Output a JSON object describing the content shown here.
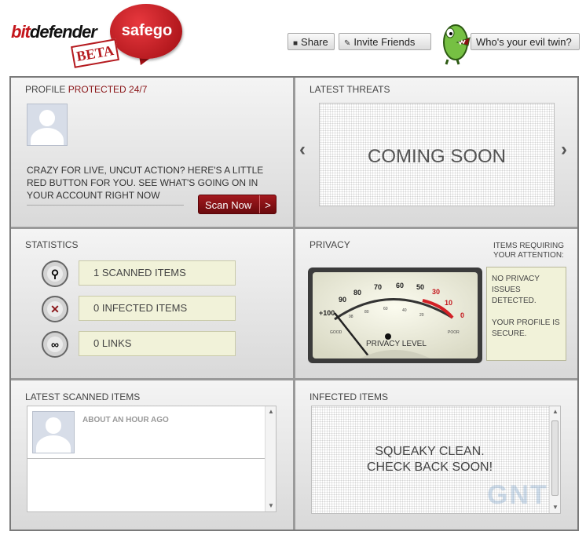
{
  "header": {
    "logo_part1": "bit",
    "logo_part2": "defender",
    "bubble_text": "safego",
    "beta_stamp": "BETA",
    "share_label": "Share",
    "invite_label": "Invite Friends",
    "evil_twin_label": "Who's your evil twin?"
  },
  "profile": {
    "title": "PROFILE",
    "title_highlight": "PROTECTED 24/7",
    "description": "CRAZY FOR LIVE, UNCUT ACTION? HERE'S A LITTLE RED BUTTON FOR YOU. SEE WHAT'S GOING ON IN YOUR ACCOUNT RIGHT NOW",
    "scan_button": "Scan Now",
    "scan_arrow": ">"
  },
  "latest_threats": {
    "title": "LATEST THREATS",
    "placeholder": "COMING SOON",
    "prev_arrow": "‹",
    "next_arrow": "›"
  },
  "statistics": {
    "title": "STATISTICS",
    "items": [
      {
        "icon": "magnifier-icon",
        "label": "1 SCANNED ITEMS"
      },
      {
        "icon": "infected-x-icon",
        "label": "0 INFECTED ITEMS"
      },
      {
        "icon": "link-icon",
        "label": "0 LINKS"
      }
    ]
  },
  "privacy": {
    "title": "PRIVACY",
    "attention_title": "ITEMS REQUIRING YOUR ATTENTION:",
    "attention_text_1": "NO PRIVACY ISSUES DETECTED.",
    "attention_text_2": "YOUR PROFILE IS SECURE.",
    "gauge_label": "PRIVACY LEVEL",
    "gauge_good": "GOOD",
    "gauge_poor": "POOR",
    "gauge_ticks": [
      "+100",
      "90",
      "80",
      "70",
      "60",
      "50",
      "30",
      "10",
      "0"
    ],
    "gauge_inner_ticks": [
      "98",
      "80",
      "60",
      "40",
      "20"
    ]
  },
  "latest_scanned": {
    "title": "LATEST SCANNED ITEMS",
    "items": [
      {
        "time": "ABOUT AN HOUR AGO"
      }
    ]
  },
  "infected_items": {
    "title": "INFECTED ITEMS",
    "message_line1": "SQUEAKY CLEAN.",
    "message_line2": "CHECK BACK SOON!"
  },
  "watermark": "GNT",
  "colors": {
    "brand_red": "#c4161c",
    "scan_button": "#8b1216",
    "note_bg": "#f1f2d9"
  }
}
